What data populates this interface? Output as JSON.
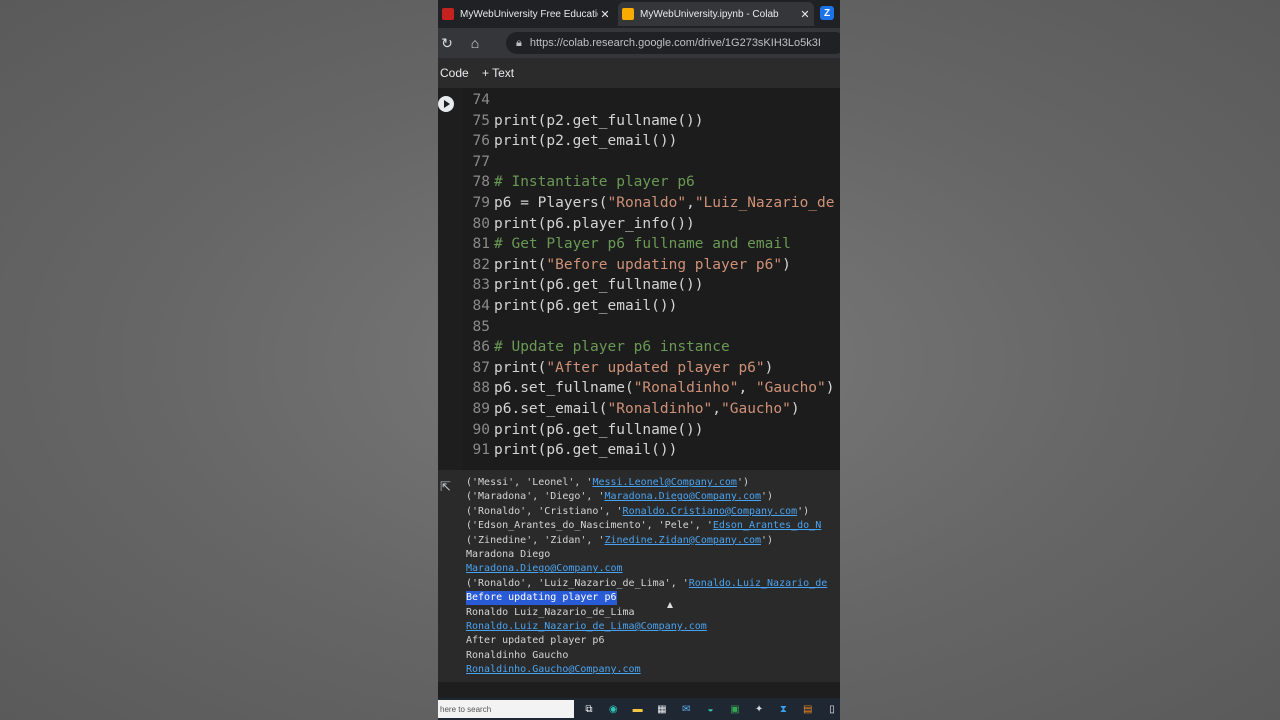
{
  "browser": {
    "tabs": [
      {
        "title": "MyWebUniversity Free Education",
        "favicon_color": "#c5221f",
        "active": false
      },
      {
        "title": "MyWebUniversity.ipynb - Colab",
        "favicon_color": "#f9ab00",
        "active": true
      }
    ],
    "tab_close_glyph": "✕",
    "extra_tab_label": "Z",
    "url": "https://colab.research.google.com/drive/1G273sKIH3Lo5k3I"
  },
  "colab": {
    "toolbar": {
      "code_label": "Code",
      "text_label": "+ Text"
    },
    "code_lines": [
      {
        "num": "74",
        "parts": [
          {
            "t": "",
            "k": "n"
          }
        ]
      },
      {
        "num": "75",
        "parts": [
          {
            "t": "print(p2.get_fullname())",
            "k": "n"
          }
        ]
      },
      {
        "num": "76",
        "parts": [
          {
            "t": "print(p2.get_email())",
            "k": "n"
          }
        ]
      },
      {
        "num": "77",
        "parts": [
          {
            "t": "",
            "k": "n"
          }
        ]
      },
      {
        "num": "78",
        "parts": [
          {
            "t": "# Instantiate player p6",
            "k": "c"
          }
        ]
      },
      {
        "num": "79",
        "parts": [
          {
            "t": "p6 = Players(",
            "k": "n"
          },
          {
            "t": "\"Ronaldo\"",
            "k": "s"
          },
          {
            "t": ",",
            "k": "n"
          },
          {
            "t": "\"Luiz_Nazario_de",
            "k": "s"
          }
        ]
      },
      {
        "num": "80",
        "parts": [
          {
            "t": "print(p6.player_info())",
            "k": "n"
          }
        ]
      },
      {
        "num": "81",
        "parts": [
          {
            "t": "# Get Player p6 fullname and email",
            "k": "c"
          }
        ]
      },
      {
        "num": "82",
        "parts": [
          {
            "t": "print(",
            "k": "n"
          },
          {
            "t": "\"Before updating player p6\"",
            "k": "s"
          },
          {
            "t": ")",
            "k": "n"
          }
        ]
      },
      {
        "num": "83",
        "parts": [
          {
            "t": "print(p6.get_fullname())",
            "k": "n"
          }
        ]
      },
      {
        "num": "84",
        "parts": [
          {
            "t": "print(p6.get_email())",
            "k": "n"
          }
        ]
      },
      {
        "num": "85",
        "parts": [
          {
            "t": "",
            "k": "n"
          }
        ]
      },
      {
        "num": "86",
        "parts": [
          {
            "t": "# Update player p6 instance",
            "k": "c"
          }
        ]
      },
      {
        "num": "87",
        "parts": [
          {
            "t": "print(",
            "k": "n"
          },
          {
            "t": "\"After updated player p6\"",
            "k": "s"
          },
          {
            "t": ")",
            "k": "n"
          }
        ]
      },
      {
        "num": "88",
        "parts": [
          {
            "t": "p6.set_fullname(",
            "k": "n"
          },
          {
            "t": "\"Ronaldinho\"",
            "k": "s"
          },
          {
            "t": ", ",
            "k": "n"
          },
          {
            "t": "\"Gaucho\"",
            "k": "s"
          },
          {
            "t": ")",
            "k": "n"
          }
        ]
      },
      {
        "num": "89",
        "parts": [
          {
            "t": "p6.set_email(",
            "k": "n"
          },
          {
            "t": "\"Ronaldinho\"",
            "k": "s"
          },
          {
            "t": ",",
            "k": "n"
          },
          {
            "t": "\"Gaucho\"",
            "k": "s"
          },
          {
            "t": ")",
            "k": "n"
          }
        ]
      },
      {
        "num": "90",
        "parts": [
          {
            "t": "print(p6.get_fullname())",
            "k": "n"
          }
        ]
      },
      {
        "num": "91",
        "parts": [
          {
            "t": "print(p6.get_email())",
            "k": "n"
          }
        ]
      }
    ],
    "output_lines": [
      {
        "kind": "tuple",
        "text": "('Messi', 'Leonel', '",
        "link": "Messi.Leonel@Company.com",
        "tail": "')"
      },
      {
        "kind": "tuple",
        "text": "('Maradona', 'Diego', '",
        "link": "Maradona.Diego@Company.com",
        "tail": "')"
      },
      {
        "kind": "tuple",
        "text": "('Ronaldo', 'Cristiano', '",
        "link": "Ronaldo.Cristiano@Company.com",
        "tail": "')"
      },
      {
        "kind": "tuple",
        "text": "('Edson_Arantes_do_Nascimento', 'Pele', '",
        "link": "Edson_Arantes_do_N",
        "tail": ""
      },
      {
        "kind": "tuple",
        "text": "('Zinedine', 'Zidan', '",
        "link": "Zinedine.Zidan@Company.com",
        "tail": "')"
      },
      {
        "kind": "plain",
        "text": "Maradona Diego"
      },
      {
        "kind": "link",
        "text": "Maradona.Diego@Company.com"
      },
      {
        "kind": "tuple",
        "text": "('Ronaldo', 'Luiz_Nazario_de_Lima', '",
        "link": "Ronaldo.Luiz_Nazario_de",
        "tail": ""
      },
      {
        "kind": "selected",
        "text": "Before updating player p6"
      },
      {
        "kind": "plain",
        "text": "Ronaldo Luiz_Nazario_de_Lima"
      },
      {
        "kind": "link",
        "text": "Ronaldo.Luiz_Nazario_de_Lima@Company.com"
      },
      {
        "kind": "plain",
        "text": "After updated player p6"
      },
      {
        "kind": "plain",
        "text": "Ronaldinho Gaucho"
      },
      {
        "kind": "link",
        "text": "Ronaldinho.Gaucho@Company.com"
      }
    ]
  },
  "taskbar": {
    "search_placeholder": "here to search",
    "apps": [
      {
        "name": "task-view-icon",
        "glyph": "⧉",
        "color": "#ffffff"
      },
      {
        "name": "edge-icon",
        "glyph": "◉",
        "color": "#2ec4b6"
      },
      {
        "name": "file-explorer-icon",
        "glyph": "▬",
        "color": "#f4c542"
      },
      {
        "name": "store-icon",
        "glyph": "▦",
        "color": "#e8eaed"
      },
      {
        "name": "mail-icon",
        "glyph": "✉",
        "color": "#5ab4f0"
      },
      {
        "name": "edge-dev-icon",
        "glyph": "◒",
        "color": "#35c0a8"
      },
      {
        "name": "excel-icon",
        "glyph": "▣",
        "color": "#33a852"
      },
      {
        "name": "network-icon",
        "glyph": "✦",
        "color": "#cfd8e3"
      },
      {
        "name": "vscode-icon",
        "glyph": "⧗",
        "color": "#3aa0f0"
      },
      {
        "name": "acrobat-icon",
        "glyph": "▤",
        "color": "#f08a24"
      },
      {
        "name": "notepad-icon",
        "glyph": "▯",
        "color": "#e8eaed"
      }
    ]
  }
}
